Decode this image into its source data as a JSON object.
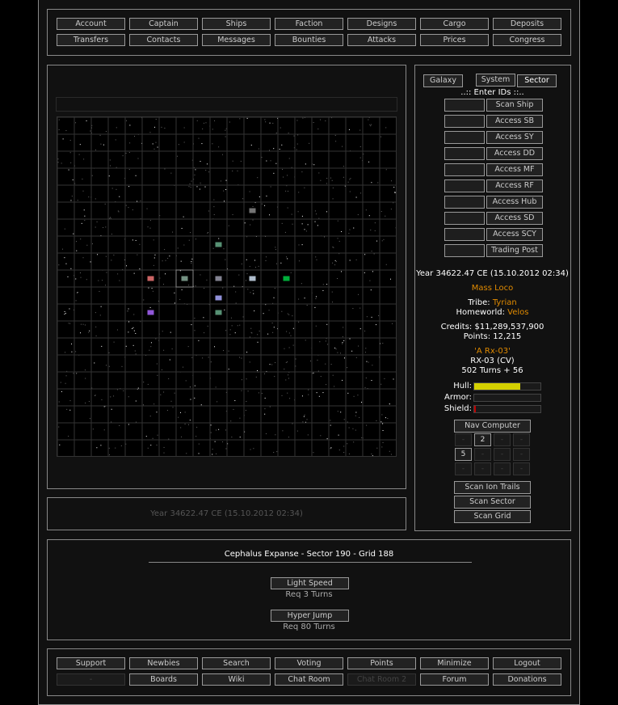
{
  "top_nav": [
    [
      "Account",
      "Captain",
      "Ships",
      "Faction",
      "Designs",
      "Cargo",
      "Deposits"
    ],
    [
      "Transfers",
      "Contacts",
      "Messages",
      "Bounties",
      "Attacks",
      "Prices",
      "Congress"
    ]
  ],
  "view_tabs": [
    "Galaxy",
    "System",
    "Sector"
  ],
  "enter_ids": "..:: Enter IDs ::..",
  "id_actions": [
    "Scan Ship",
    "Access SB",
    "Access SY",
    "Access DD",
    "Access MF",
    "Access RF",
    "Access Hub",
    "Access SD",
    "Access SCY",
    "Trading Post"
  ],
  "status": {
    "date": "Year 34622.47 CE (15.10.2012 02:34)",
    "player": "Mass Loco",
    "tribe_label": "Tribe:",
    "tribe": "Tyrian",
    "homeworld_label": "Homeworld:",
    "homeworld": "Velos",
    "credits": "Credits: $11,289,537,900",
    "points": "Points: 12,215",
    "ship_name": "'A Rx-03'",
    "ship_class": "RX-03 (CV)",
    "turns": "502 Turns + 56"
  },
  "bars": [
    {
      "label": "Hull:",
      "value": 0.7,
      "color": "#d4d000"
    },
    {
      "label": "Armor:",
      "value": 0,
      "color": "#888"
    },
    {
      "label": "Shield:",
      "value": 0.03,
      "color": "#c00000"
    }
  ],
  "nav_computer": {
    "label": "Nav Computer",
    "cells": [
      "-",
      "2",
      "-",
      "-",
      "5",
      "-",
      "-",
      "-",
      "-",
      "-",
      "-",
      "-"
    ],
    "active": [
      1,
      4
    ]
  },
  "scan_buttons": [
    "Scan Ion Trails",
    "Scan Sector",
    "Scan Grid"
  ],
  "map_footer": "Year 34622.47 CE (15.10.2012 02:34)",
  "location": "Cephalus Expanse - Sector 190 - Grid 188",
  "travel": [
    {
      "label": "Light Speed",
      "req": "Req 3 Turns"
    },
    {
      "label": "Hyper Jump",
      "req": "Req 80 Turns"
    }
  ],
  "bottom_nav": [
    [
      "Support",
      "Newbies",
      "Search",
      "Voting",
      "Points",
      "Minimize",
      "Logout"
    ],
    [
      "-",
      "Boards",
      "Wiki",
      "Chat Room",
      "Chat Room 2",
      "Forum",
      "Donations"
    ]
  ],
  "bottom_disabled": [
    "-",
    "Chat Room 2"
  ],
  "map_objects": [
    {
      "name": "starbase",
      "col": 11,
      "row": 5,
      "color": "#888"
    },
    {
      "name": "planet-green",
      "col": 9,
      "row": 7,
      "color": "#6a8"
    },
    {
      "name": "ship-red",
      "col": 5,
      "row": 9,
      "color": "#e77"
    },
    {
      "name": "own-ship",
      "col": 7,
      "row": 9,
      "color": "#8a9"
    },
    {
      "name": "asteroid",
      "col": 9,
      "row": 9,
      "color": "#99a"
    },
    {
      "name": "station-white",
      "col": 11,
      "row": 9,
      "color": "#cde"
    },
    {
      "name": "ship-green",
      "col": 13,
      "row": 9,
      "color": "#0c4"
    },
    {
      "name": "ship-purple",
      "col": 5,
      "row": 11,
      "color": "#a6f"
    },
    {
      "name": "planet-green-2",
      "col": 9,
      "row": 11,
      "color": "#6a8"
    },
    {
      "name": "ship-small",
      "col": 9,
      "row": 10,
      "color": "#aaf"
    }
  ],
  "selected_cell": {
    "col": 7,
    "row": 9
  }
}
